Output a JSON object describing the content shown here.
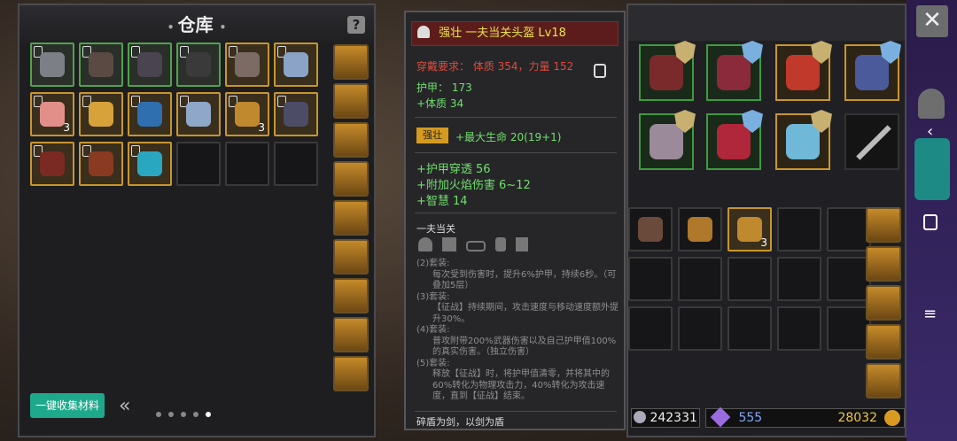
{
  "warehouse": {
    "title": "仓库",
    "collect_button": "一键收集材料",
    "pager_icon": "double-chevron-left-icon",
    "page_count": 5,
    "current_page": 5,
    "slots": [
      {
        "frame": "green",
        "color": "#7c7f86",
        "count": ""
      },
      {
        "frame": "green",
        "color": "#5b4a44",
        "count": ""
      },
      {
        "frame": "green",
        "color": "#4a4350",
        "count": ""
      },
      {
        "frame": "green",
        "color": "#3a3a3a",
        "count": ""
      },
      {
        "frame": "gold",
        "color": "#7b6b64",
        "count": ""
      },
      {
        "frame": "gold",
        "color": "#8aa3c7",
        "count": ""
      },
      {
        "frame": "gold",
        "color": "#e28f8a",
        "count": "3"
      },
      {
        "frame": "gold",
        "color": "#d8a23a",
        "count": ""
      },
      {
        "frame": "gold",
        "color": "#2f6fb0",
        "count": ""
      },
      {
        "frame": "gold",
        "color": "#8fa7c8",
        "count": ""
      },
      {
        "frame": "gold",
        "color": "#c0892d",
        "count": "3"
      },
      {
        "frame": "gold",
        "color": "#4c4c66",
        "count": ""
      },
      {
        "frame": "gold",
        "color": "#7a2a22",
        "count": ""
      },
      {
        "frame": "gold",
        "color": "#8a3a22",
        "count": ""
      },
      {
        "frame": "gold",
        "color": "#2aa7c0",
        "count": ""
      }
    ]
  },
  "tooltip": {
    "title": "强壮  一夫当关头盔  Lv18",
    "requirement": "穿戴要求：  体质 354，力量 152",
    "armor": "护甲：  173",
    "constitution": "+体质  34",
    "affix_tag": "强壮",
    "affix_text": "+最大生命 20(19+1)",
    "stats": [
      "+护甲穿透  56",
      "+附加火焰伤害  6~12",
      "+智慧  14"
    ],
    "set_name": "一夫当关",
    "set_bonus": [
      "(2)套装:",
      "每次受到伤害时，提升6%护甲，持续6秒。（可叠加5层）",
      "(3)套装:",
      "【征战】持续期间，攻击速度与移动速度额外提升30%。",
      "(4)套装:",
      "普攻附带200%武器伤害以及自己护甲值100%的真实伤害。（独立伤害）",
      "(5)套装:",
      "释放【征战】时，将护甲值清零，并将其中的60%转化为物理攻击力，40%转化为攻击速度，直到【征战】结束。"
    ],
    "flavor": "碎盾为剑，以剑为盾"
  },
  "equipment": [
    {
      "color": "#7a2a2a",
      "frame": "green"
    },
    {
      "color": "#8a2a3a",
      "frame": "green"
    },
    {
      "color": "#c0392b",
      "frame": "gold"
    },
    {
      "color": "#4a5a9a",
      "frame": "gold"
    },
    {
      "color": "#9a8a9a",
      "frame": "green"
    },
    {
      "color": "#b0263a",
      "frame": "green"
    },
    {
      "color": "#6fb8d8",
      "frame": "gold"
    }
  ],
  "inventory": [
    {
      "color": "#6a4a3a",
      "count": ""
    },
    {
      "color": "#b0782a",
      "count": ""
    },
    {
      "color": "#c0892d",
      "count": "3"
    }
  ],
  "currency": {
    "silver": "242331",
    "gems": "555",
    "gold": "28032"
  },
  "sidebar": {
    "close": "✕"
  }
}
